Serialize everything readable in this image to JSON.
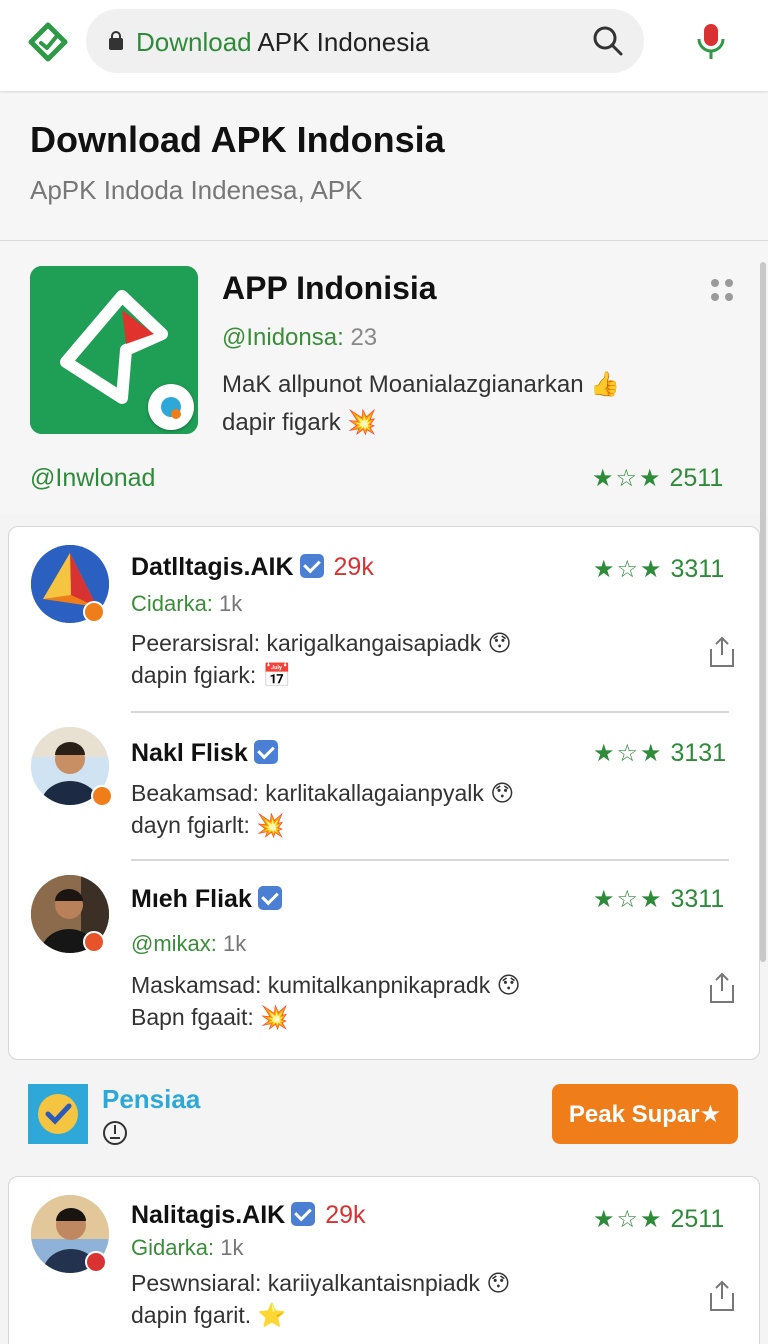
{
  "browser": {
    "url_highlight": "Download",
    "url_rest": " APK Indonesia"
  },
  "header": {
    "title": "Download APK Indonsia",
    "subtitle": "ApPK Indoda Indenesa, APK"
  },
  "featured_app": {
    "name": "APP Indonisia",
    "handle": "@Inidonsa:",
    "handle_count": "23",
    "description_line1": "MaK allpunot Moanialazgianarkan",
    "description_line2": "dapir figark",
    "download_link": "@Inwlonad",
    "rating_stars": "★☆★",
    "rating_count": "2511"
  },
  "reviews": [
    {
      "name": "Datlltagis.AIK",
      "count": "29k",
      "handle": "Cidarka:",
      "handle_count": "1k",
      "text_line1": "Peerarsisral: karigalkangaisapiadk",
      "text_line2": "dapin fgiark:",
      "rating_stars": "★☆★",
      "rating_count": "3311"
    },
    {
      "name": "Nakl Flisk",
      "count": "",
      "handle": "",
      "handle_count": "",
      "text_line1": "Beakamsad: karlitakallagaianpyalk",
      "text_line2": "dayn fgiarlt:",
      "rating_stars": "★☆★",
      "rating_count": "3131"
    },
    {
      "name": "Mıeh Fliak",
      "count": "",
      "handle": "@mikax:",
      "handle_count": "1k",
      "text_line1": "Maskamsad: kumitalkanpnikapradk",
      "text_line2": "Bapn fgaait:",
      "rating_stars": "★☆★",
      "rating_count": "3311"
    }
  ],
  "promo": {
    "title": "Pensiaa",
    "button_label": "Peak Supar★"
  },
  "bottom_review": {
    "name": "Nalitagis.AIK",
    "count": "29k",
    "handle": "Gidarka:",
    "handle_count": "1k",
    "text_line1": "Peswnsiaral: kariiyalkantaisnpiadk",
    "text_line2": "dapin fgarit.",
    "rating_stars": "★☆★",
    "rating_count": "2511"
  },
  "colors": {
    "brand_green": "#2e8b3a",
    "accent_red": "#d83232",
    "promo_orange": "#ef7d1a",
    "promo_blue": "#2ea8d8"
  }
}
